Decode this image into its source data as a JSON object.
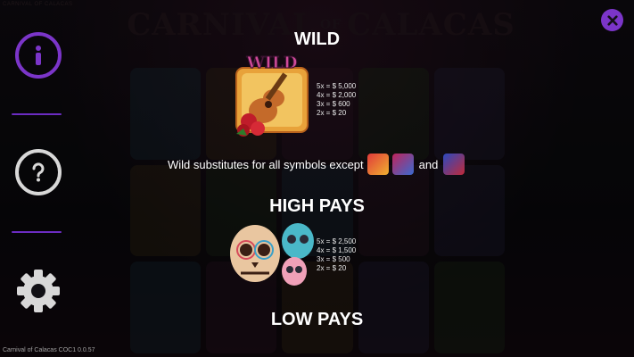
{
  "backdrop": {
    "corner_label": "CARNIVAL OF CALACAS",
    "logo_word1": "CARNIVAL",
    "logo_of": "OF",
    "logo_word2": "CALACAS"
  },
  "sidebar": {
    "info_icon": "info-icon",
    "help_icon": "question-icon",
    "settings_icon": "gear-icon",
    "accent_color": "#7b35c9"
  },
  "close_icon": "close-icon",
  "wild": {
    "title": "WILD",
    "symbol_label": "WILD",
    "pays": [
      "5x = $ 5,000",
      "4x = $ 2,000",
      "3x = $ 600",
      "2x = $ 20"
    ],
    "substitute_text": "Wild substitutes for all symbols except",
    "and_word": "and",
    "except_icons": [
      "scatter-icon",
      "bonus-icon",
      "catrina-icon"
    ]
  },
  "high_pays": {
    "title": "HIGH PAYS",
    "pays": [
      "5x = $ 2,500",
      "4x = $ 1,500",
      "3x = $ 500",
      "2x = $ 20"
    ]
  },
  "low_pays": {
    "title": "LOW PAYS"
  },
  "footer": {
    "version": "Carnival of Calacas COC1 0.0.57"
  }
}
